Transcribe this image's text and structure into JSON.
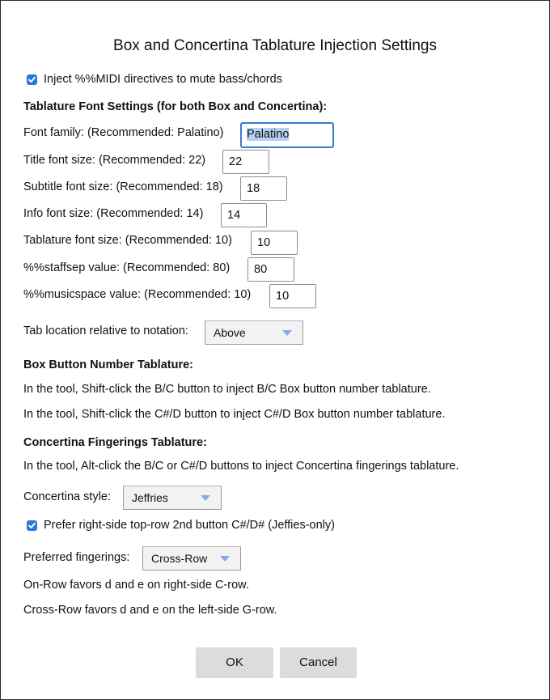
{
  "dialog": {
    "title": "Box and Concertina Tablature Injection Settings"
  },
  "midi_mute": {
    "checked": true,
    "label": "Inject %%MIDI directives to mute bass/chords"
  },
  "font_settings": {
    "heading": "Tablature Font Settings (for both Box and Concertina):",
    "font_family": {
      "label": "Font family: (Recommended: Palatino)",
      "value": "Palatino"
    },
    "title_size": {
      "label": "Title font size: (Recommended: 22)",
      "value": "22"
    },
    "subtitle_size": {
      "label": "Subtitle font size: (Recommended: 18)",
      "value": "18"
    },
    "info_size": {
      "label": "Info font size: (Recommended: 14)",
      "value": "14"
    },
    "tab_size": {
      "label": "Tablature font size: (Recommended: 10)",
      "value": "10"
    },
    "staffsep": {
      "label": "%%staffsep value: (Recommended: 80)",
      "value": "80"
    },
    "musicspace": {
      "label": "%%musicspace value: (Recommended: 10)",
      "value": "10"
    }
  },
  "tab_location": {
    "label": "Tab location relative to notation:",
    "selected": "Above"
  },
  "box": {
    "heading": "Box Button Number Tablature:",
    "line1": "In the tool, Shift-click the B/C button to inject B/C Box button number tablature.",
    "line2": "In the tool, Shift-click the C#/D button to inject C#/D Box button number tablature."
  },
  "concertina": {
    "heading": "Concertina Fingerings Tablature:",
    "line1": "In the tool, Alt-click the B/C or C#/D buttons to inject Concertina fingerings tablature.",
    "style_label": "Concertina style:",
    "style_selected": "Jeffries",
    "prefer": {
      "checked": true,
      "label": "Prefer right-side top-row 2nd button C#/D# (Jeffies-only)"
    },
    "fingerings_label": "Preferred fingerings:",
    "fingerings_selected": "Cross-Row",
    "note1": "On-Row favors d and e on right-side C-row.",
    "note2": "Cross-Row favors d and e on the left-side G-row."
  },
  "buttons": {
    "ok": "OK",
    "cancel": "Cancel"
  },
  "colors": {
    "accent": "#2b78d8",
    "focus_border": "#3a7bd5",
    "selection": "#b4d1f3",
    "button_bg": "#dcdcdc",
    "dropdown_arrow": "#8aa8e6"
  }
}
